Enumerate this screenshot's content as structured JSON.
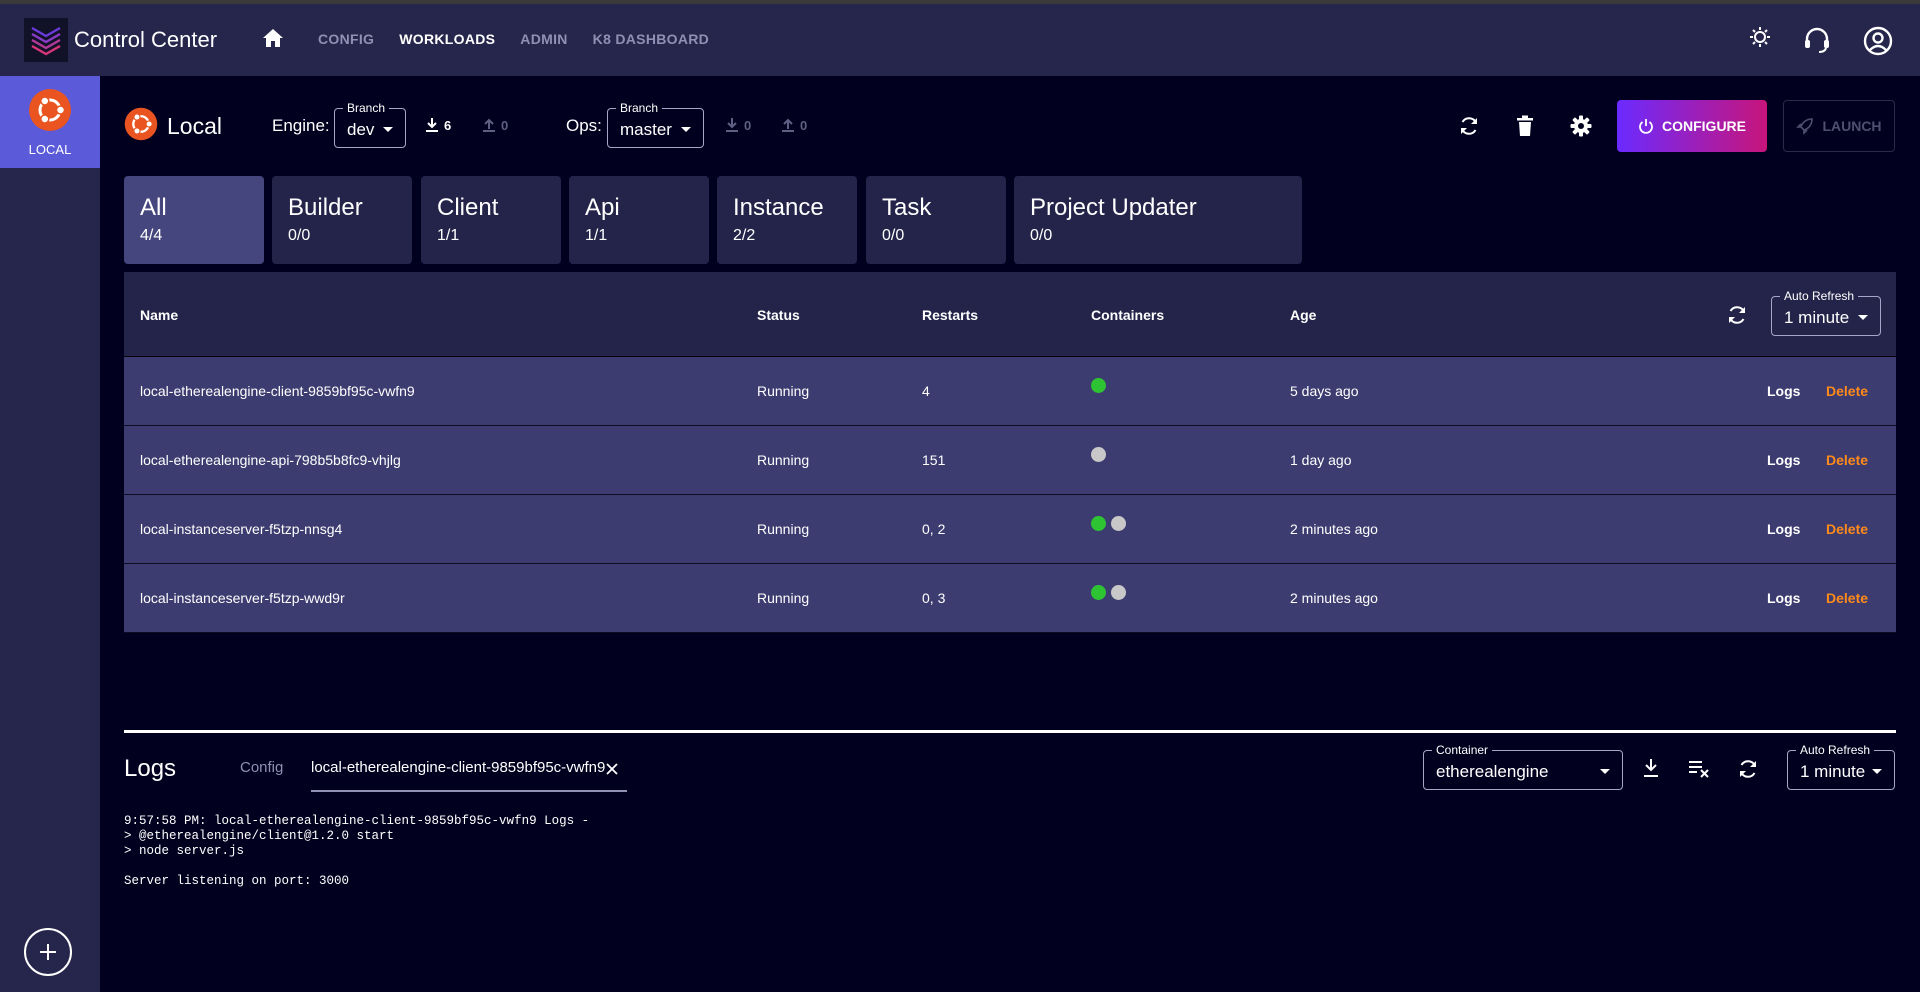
{
  "app": {
    "title": "Control Center"
  },
  "nav": {
    "items": [
      {
        "label": "CONFIG",
        "active": false
      },
      {
        "label": "WORKLOADS",
        "active": true
      },
      {
        "label": "ADMIN",
        "active": false
      },
      {
        "label": "K8 DASHBOARD",
        "active": false
      }
    ]
  },
  "sidebar": {
    "local_label": "LOCAL"
  },
  "toolbar": {
    "cluster_name": "Local",
    "engine_label": "Engine:",
    "engine_branch_legend": "Branch",
    "engine_branch_value": "dev",
    "engine_behind": "6",
    "engine_ahead": "0",
    "ops_label": "Ops:",
    "ops_branch_legend": "Branch",
    "ops_branch_value": "master",
    "ops_behind": "0",
    "ops_ahead": "0",
    "configure_label": "CONFIGURE",
    "launch_label": "LAUNCH"
  },
  "tabs": [
    {
      "name": "All",
      "count": "4/4"
    },
    {
      "name": "Builder",
      "count": "0/0"
    },
    {
      "name": "Client",
      "count": "1/1"
    },
    {
      "name": "Api",
      "count": "1/1"
    },
    {
      "name": "Instance",
      "count": "2/2"
    },
    {
      "name": "Task",
      "count": "0/0"
    },
    {
      "name": "Project Updater",
      "count": "0/0"
    }
  ],
  "table": {
    "headers": {
      "name": "Name",
      "status": "Status",
      "restarts": "Restarts",
      "containers": "Containers",
      "age": "Age"
    },
    "auto_refresh_legend": "Auto Refresh",
    "auto_refresh_value": "1 minute",
    "logs_label": "Logs",
    "delete_label": "Delete",
    "rows": [
      {
        "name": "local-etherealengine-client-9859bf95c-vwfn9",
        "status": "Running",
        "restarts": "4",
        "containers": [
          "green"
        ],
        "age": "5 days ago"
      },
      {
        "name": "local-etherealengine-api-798b5b8fc9-vhjlg",
        "status": "Running",
        "restarts": "151",
        "containers": [
          "grey"
        ],
        "age": "1 day ago"
      },
      {
        "name": "local-instanceserver-f5tzp-nnsg4",
        "status": "Running",
        "restarts": "0, 2",
        "containers": [
          "green",
          "grey"
        ],
        "age": "2 minutes ago"
      },
      {
        "name": "local-instanceserver-f5tzp-wwd9r",
        "status": "Running",
        "restarts": "0, 3",
        "containers": [
          "green",
          "grey"
        ],
        "age": "2 minutes ago"
      }
    ]
  },
  "logs": {
    "title": "Logs",
    "tab_config": "Config",
    "tab_pod": "local-etherealengine-client-9859bf95c-vwfn9",
    "container_legend": "Container",
    "container_value": "etherealengine",
    "auto_refresh_legend": "Auto Refresh",
    "auto_refresh_value": "1 minute",
    "lines": [
      "9:57:58 PM: local-etherealengine-client-9859bf95c-vwfn9 Logs -",
      "> @etherealengine/client@1.2.0 start",
      "> node server.js",
      "",
      "Server listening on port: 3000"
    ]
  },
  "colors": {
    "header_bg": "#26264c",
    "sidebar_active": "#5b5bd9",
    "page_bg": "#02001f",
    "row_bg": "#3c3c70",
    "status_green": "#2ec333",
    "status_grey": "#c8c8c8",
    "delete_orange": "#ff8a1a",
    "ubuntu_orange": "#e95420"
  },
  "icons": [
    "home-icon",
    "theme-toggle-icon",
    "support-icon",
    "account-icon",
    "ubuntu-icon",
    "download-icon",
    "upload-icon",
    "refresh-icon",
    "trash-icon",
    "gear-icon",
    "power-icon",
    "rocket-icon",
    "close-icon",
    "clear-list-icon",
    "plus-icon"
  ]
}
